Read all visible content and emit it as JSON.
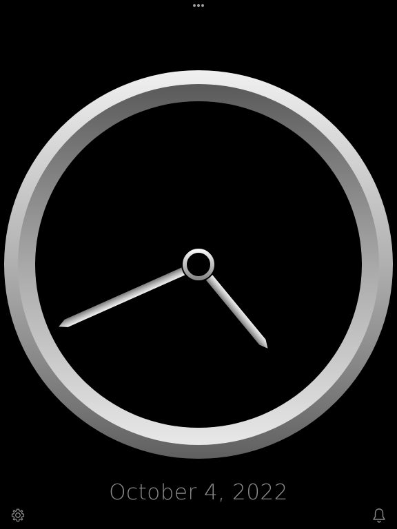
{
  "toolbar": {
    "more_icon": "ellipsis-icon"
  },
  "clock": {
    "time": {
      "hour": 4,
      "minute": 41
    },
    "bezel_color_light": "#e8e8e8",
    "bezel_color_dark": "#6a6a6a",
    "face_color": "#000000",
    "hand_color": "#c8c8c8"
  },
  "date": {
    "text": "October 4, 2022",
    "color": "#8a8a8a"
  },
  "footer": {
    "settings_icon": "gear-icon",
    "alarm_icon": "bell-icon",
    "icon_color": "#8a8a8a"
  }
}
